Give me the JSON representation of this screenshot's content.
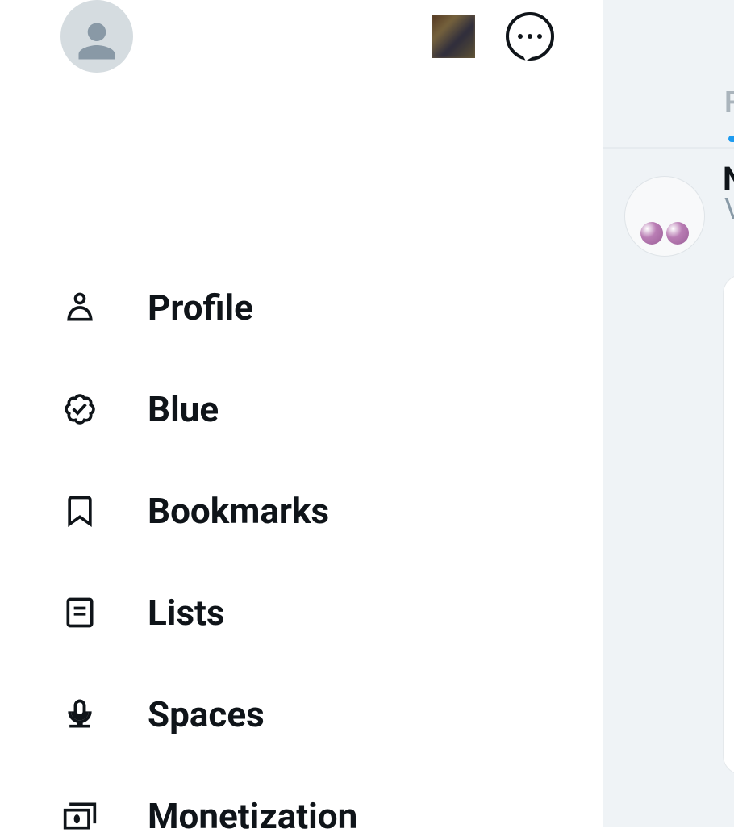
{
  "nav": {
    "items": [
      {
        "label": "Profile"
      },
      {
        "label": "Blue"
      },
      {
        "label": "Bookmarks"
      },
      {
        "label": "Lists"
      },
      {
        "label": "Spaces"
      },
      {
        "label": "Monetization"
      }
    ]
  },
  "right": {
    "partial_text_1": "F",
    "partial_text_2": "N",
    "partial_text_3": "V"
  }
}
